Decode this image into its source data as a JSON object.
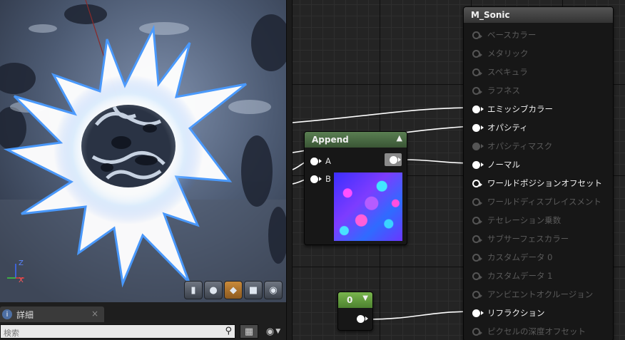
{
  "material": {
    "title": "M_Sonic",
    "pins": [
      {
        "label": "ベースカラー",
        "state": "disabled"
      },
      {
        "label": "メタリック",
        "state": "disabled"
      },
      {
        "label": "スペキュラ",
        "state": "disabled"
      },
      {
        "label": "ラフネス",
        "state": "disabled"
      },
      {
        "label": "エミッシブカラー",
        "state": "connected"
      },
      {
        "label": "オパシティ",
        "state": "connected"
      },
      {
        "label": "オパシティマスク",
        "state": "disabled"
      },
      {
        "label": "ノーマル",
        "state": "connected"
      },
      {
        "label": "ワールドポジションオフセット",
        "state": "enabled"
      },
      {
        "label": "ワールドディスプレイスメント",
        "state": "disabled"
      },
      {
        "label": "テセレーション乗数",
        "state": "disabled"
      },
      {
        "label": "サブサーフェスカラー",
        "state": "disabled"
      },
      {
        "label": "カスタムデータ 0",
        "state": "disabled"
      },
      {
        "label": "カスタムデータ 1",
        "state": "disabled"
      },
      {
        "label": "アンビエントオクルージョン",
        "state": "disabled"
      },
      {
        "label": "リフラクション",
        "state": "connected"
      },
      {
        "label": "ピクセルの深度オフセット",
        "state": "disabled"
      }
    ]
  },
  "append_node": {
    "title": "Append",
    "input_a": "A",
    "input_b": "B"
  },
  "constant_node": {
    "value": "0"
  },
  "details_panel": {
    "tab_label": "詳細",
    "tab_close": "×",
    "search_placeholder": "検索"
  },
  "viewport": {
    "axis_z": "Z",
    "axis_x": "X",
    "buttons": [
      "cylinder-preview",
      "sphere-preview",
      "plane-preview",
      "cube-preview",
      "mesh-preview"
    ],
    "active_button": "plane-preview"
  },
  "colors": {
    "material_header": "#3f3f3f",
    "append_header": "#4a6b44",
    "constant_header": "#5f9a3c",
    "wire": "#ffffff",
    "disabled_text": "#5a5a5a",
    "enabled_text": "#f2f2f2"
  }
}
